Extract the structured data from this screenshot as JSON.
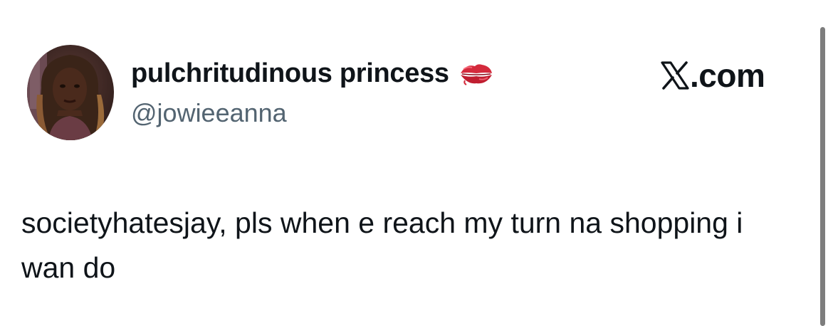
{
  "tweet": {
    "author": {
      "display_name": "pulchritudinous princess",
      "name_emoji": "kiss-mark-icon",
      "handle": "@jowieeanna",
      "avatar": "profile-photo"
    },
    "text": "societyhatesjay, pls when e reach my turn na shopping i wan do"
  },
  "brand": {
    "logo": "x-logo-icon",
    "text": ".com"
  },
  "colors": {
    "text_primary": "#0f1419",
    "text_secondary": "#536471",
    "background": "#ffffff",
    "scrollbar": "#7d7d7d"
  }
}
